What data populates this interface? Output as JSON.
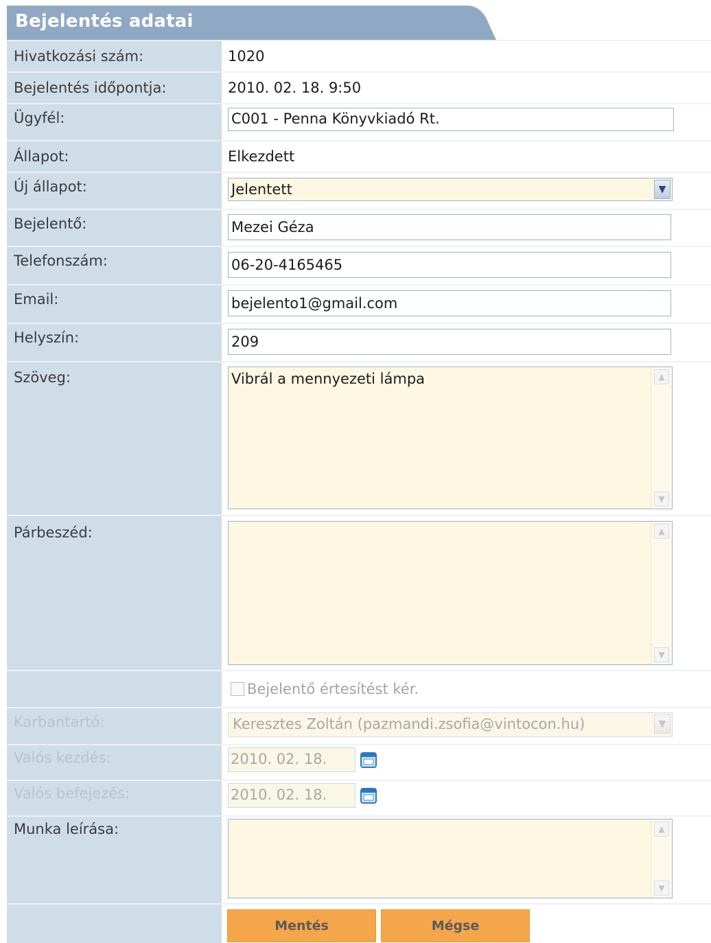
{
  "section": {
    "title": "Bejelentés adatai"
  },
  "fields": {
    "ref": {
      "label": "Hivatkozási szám:",
      "value": "1020"
    },
    "time": {
      "label": "Bejelentés időpontja:",
      "value": "2010. 02. 18. 9:50"
    },
    "client": {
      "label": "Ügyfél:",
      "value": "C001 - Penna Könyvkiadó Rt."
    },
    "state": {
      "label": "Állapot:",
      "value": "Elkezdett"
    },
    "new_state": {
      "label": "Új állapot:",
      "value": "Jelentett"
    },
    "reporter": {
      "label": "Bejelentő:",
      "value": "Mezei Géza"
    },
    "phone": {
      "label": "Telefonszám:",
      "value": "06-20-4165465"
    },
    "email": {
      "label": "Email:",
      "value": "bejelento1@gmail.com"
    },
    "location": {
      "label": "Helyszín:",
      "value": "209"
    },
    "text": {
      "label": "Szöveg:",
      "value": "Vibrál a mennyezeti lámpa"
    },
    "dialog": {
      "label": "Párbeszéd:",
      "value": ""
    },
    "notify": {
      "label": "Bejelentő értesítést kér.",
      "checked": false
    },
    "maintainer": {
      "label": "Karbantartó:",
      "value": "Keresztes Zoltán (pazmandi.zsofia@vintocon.hu)"
    },
    "real_start": {
      "label": "Valós kezdés:",
      "value": "2010. 02. 18."
    },
    "real_end": {
      "label": "Valós befejezés:",
      "value": "2010. 02. 18."
    },
    "work_desc": {
      "label": "Munka leírása:",
      "value": ""
    }
  },
  "buttons": {
    "save": "Mentés",
    "cancel": "Mégse"
  },
  "icons": {
    "select_arrow": "chevron-down-icon",
    "scroll_up": "arrow-up-icon",
    "scroll_down": "arrow-down-icon",
    "calendar": "calendar-icon"
  },
  "colors": {
    "header": "#8fa9c4",
    "label_column": "#cfdde9",
    "field_bg": "#fef8e3",
    "button": "#f5a54a"
  }
}
